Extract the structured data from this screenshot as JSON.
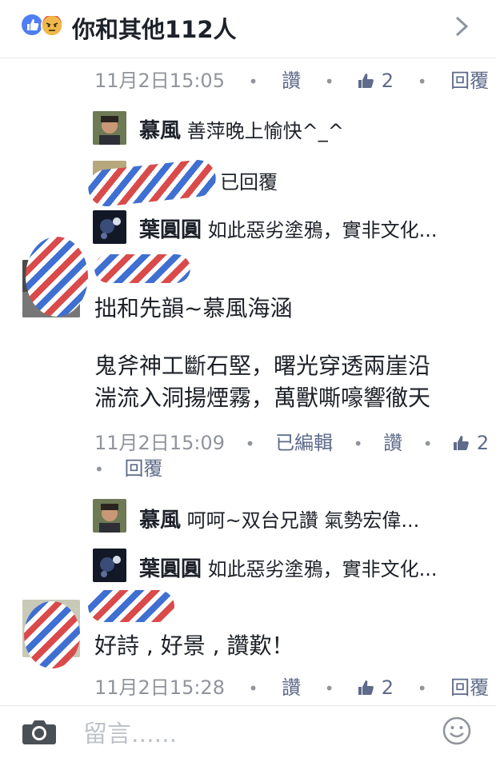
{
  "header": {
    "title": "你和其他112人",
    "reactions": [
      "like-icon",
      "angry-icon"
    ],
    "colors": {
      "like": "#4f7df2",
      "angry": "#ee7a44"
    }
  },
  "comments": [
    {
      "meta": {
        "time": "11月2日15:05",
        "like": "讚",
        "likes": "2",
        "reply": "回覆"
      },
      "replies": [
        {
          "name": "慕風",
          "text": "善萍晚上愉快^_^"
        },
        {
          "name": "",
          "text": "已回覆"
        },
        {
          "name": "葉圓圓",
          "text": "如此惡劣塗鴉，實非文化..."
        }
      ]
    },
    {
      "author": "",
      "lines": [
        "拙和先韻~慕風海涵",
        "",
        "鬼斧神工斷石堅，曙光穿透兩崖沿",
        "湍流入洞揚煙霧，萬獸嘶嚎響徹天"
      ],
      "meta": {
        "time": "11月2日15:09",
        "edited": "已編輯",
        "like": "讚",
        "likes": "2",
        "reply": "回覆"
      },
      "replies": [
        {
          "name": "慕風",
          "text": "呵呵~双台兄讚 氣勢宏偉..."
        },
        {
          "name": "葉圓圓",
          "text": "如此惡劣塗鴉，實非文化..."
        }
      ]
    },
    {
      "author": "",
      "lines": [
        "好詩 , 好景 , 讚歎！"
      ],
      "meta": {
        "time": "11月2日15:28",
        "like": "讚",
        "likes": "2",
        "reply": "回覆"
      }
    }
  ],
  "composer": {
    "placeholder": "留言......",
    "camera_icon": "camera-icon",
    "emoji_icon": "smiley-icon"
  },
  "colors": {
    "meta_text": "#90949c",
    "link": "#5f6b8a",
    "divider": "#e5e6ea"
  }
}
